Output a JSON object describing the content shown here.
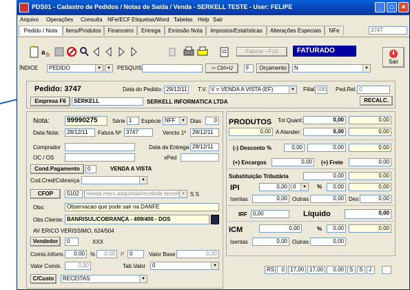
{
  "window": {
    "title": "PDS01 - Cadastro de Pedidos / Notas de Saída / Venda - SERKELL TESTE - User: FELIPE"
  },
  "menu": [
    "Arquivo",
    "Operações",
    "Consulta",
    "NFe/ECF",
    "Etiquetas/Word",
    "Tabelas",
    "Help",
    "Sair"
  ],
  "tabs": [
    "Pedido / Nota",
    "Itens/Produtos",
    "Financeiro",
    "Entrega",
    "Emissão Nota",
    "Impostos/Estatísticas",
    "Alterações Especiais",
    "NFe"
  ],
  "tab_right_value": "3747",
  "toolbar": {
    "faturar": "Faturar - F10",
    "status": "FATURADO",
    "sair": "Sair",
    "orcamento": "Orçamento",
    "ctrl_u": "Ctrl+U"
  },
  "search": {
    "indice_label": "ÍNDICE",
    "indice_value": "PEDIDO",
    "pesquisa_label": "PESQUISA",
    "f_value": "F",
    "n_value": "N"
  },
  "header": {
    "pedido": "Pedido: 3747",
    "data_label": "Data do Pedido:",
    "data": "29/12/11",
    "tv_label": "T.V.",
    "tv_value": "V = VENDA A VISTA (EF)",
    "filial_label": "Filial",
    "filial": "000",
    "pedrel_label": "Ped.Rel.",
    "pedrel": "0",
    "empresa_btn": "Empresa F6",
    "empresa_value": "SERKELL",
    "empresa_name": "SERKELL INFORMATICA LTDA",
    "recalc": "RECALC."
  },
  "nota": {
    "nota_label": "Nota:",
    "nota": "99990275",
    "serie_label": "Série",
    "serie": "1",
    "especie_label": "Espécie",
    "especie": "NFF",
    "dias_label": "Dias",
    "dias": "0",
    "datanota_label": "Data Nota:",
    "datanota": "28/12/11",
    "fatura_label": "Fatura Nº",
    "fatura": "3747",
    "vencto_label": "Vencto 1º",
    "vencto": "28/12/11",
    "comprador_label": "Comprador",
    "entrega_label": "Data da Entrega",
    "entrega": "28/12/11",
    "oc_label": "OC / OS",
    "xped_label": "xPed",
    "condpag_btn": "Cond.Pagamento",
    "condpag": "0",
    "condpag_name": "VENDA A VISTA",
    "codcred_label": "Cod.Cred/Cobrança",
    "cfop_btn": "CFOP",
    "cfop": "5102",
    "cfop_desc": "Venda merc.adquirida/recebida terceiros",
    "cfop_ss": "S S",
    "obs_label": "Obs:",
    "obs": "Observacao que pode sair na DANFE",
    "obscli_label": "Obs.Cliente:",
    "obscli": "BANRISUL/COBRANÇA - 499/400 - DOS",
    "address": "AV ERICO VERISSIMO, 624/504",
    "vendedor_btn": "Vendedor",
    "vendedor": "0",
    "vendedor_name": "XXX",
    "comis_label": "Comis.Inform.",
    "comis": "0,00",
    "pct": "%",
    "comis2": "0,00",
    "p_label": "P",
    "p_value": "0",
    "valorbase_label": "Valor Base",
    "valorbase": "0,00",
    "valorcomis_label": "Valor Comis.",
    "valorcomis": "0,00",
    "tabvalor_label": "Tab.Valor",
    "tabvalor": "0",
    "ccusto_btn": "C/Custo",
    "ccusto": "RECEITAS"
  },
  "totais": {
    "produtos_label": "PRODUTOS",
    "totquant_label": "Tot Quant:",
    "totquant": "0,00",
    "prod_val": "0,00",
    "prod_left": "0,00",
    "atender_label": "A Atender:",
    "atender": "0,00",
    "atender_r": "0,00",
    "desconto_label": "(-) Desconto %",
    "desconto_pct": "0,00",
    "desconto": "0,00",
    "desconto_r": "0,00",
    "encargos_label": "(+) Encargos",
    "encargos": "0,00",
    "frete_label": "(+) Frete",
    "frete": "0,00",
    "frete_r": "0,00",
    "subst_label": "Substituição Tributária",
    "subst": "0,00",
    "subst_r": "0,00",
    "ipi_label": "IPI",
    "ipi": "0,00",
    "ipi_sel": "0",
    "ipi_pct_label": "%",
    "ipi_pct": "0,00",
    "ipi_r": "0,00",
    "isentas_label": "Isentas",
    "isentas": "0,00",
    "outras_label": "Outras",
    "outras": "0,00",
    "des_label": "Des",
    "des": "0,00",
    "irf_label": "IRF",
    "irf": "0,00",
    "liquido_label": "Líquido",
    "liquido": "0,00",
    "icm_label": "ICM",
    "icm": "0,00",
    "icm_pct_label": "%",
    "icm_pct": "0,00",
    "icm_r": "0,00",
    "icm_isentas": "0,00",
    "icm_outras": "0,00"
  },
  "footer": {
    "rs": "RS",
    "v1": "0",
    "v2": "17,00",
    "v3": "17,00",
    "v4": "0,00",
    "s1": "S",
    "s2": "S",
    "j": "J"
  }
}
